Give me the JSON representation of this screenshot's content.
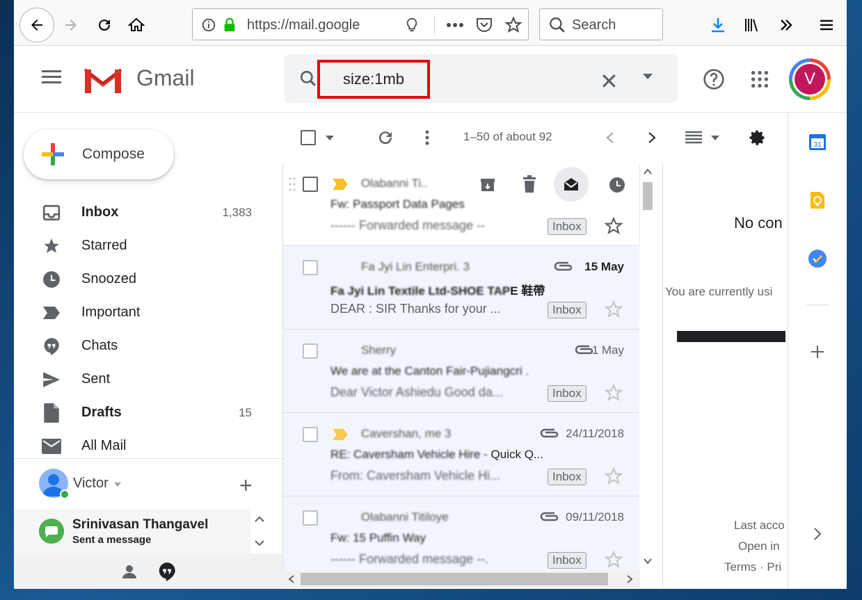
{
  "browser": {
    "url": "https://mail.google",
    "search_placeholder": "Search"
  },
  "gmail": {
    "logo_text": "Gmail",
    "search_query": "size:1mb",
    "avatar_letter": "V"
  },
  "sidebar": {
    "compose_label": "Compose",
    "items": [
      {
        "label": "Inbox",
        "count": "1,383",
        "icon": "inbox-icon",
        "bold": true
      },
      {
        "label": "Starred",
        "count": "",
        "icon": "star-icon"
      },
      {
        "label": "Snoozed",
        "count": "",
        "icon": "clock-icon"
      },
      {
        "label": "Important",
        "count": "",
        "icon": "important-icon"
      },
      {
        "label": "Chats",
        "count": "",
        "icon": "chat-icon"
      },
      {
        "label": "Sent",
        "count": "",
        "icon": "send-icon"
      },
      {
        "label": "Drafts",
        "count": "15",
        "icon": "draft-icon",
        "bold": true
      },
      {
        "label": "All Mail",
        "count": "",
        "icon": "mail-icon"
      }
    ],
    "hangouts_user": "Victor",
    "conversation": {
      "name": "Srinivasan Thangavel",
      "status": "Sent a message"
    }
  },
  "toolbar": {
    "paging": "1–50 of about 92"
  },
  "messages": [
    {
      "sender": "Olabanni Ti..",
      "subject": "Fw: Passport Data Pages",
      "snippet_blur": "------ Forwarded message --",
      "date": "",
      "label": "Inbox"
    },
    {
      "sender": "Fa Jyi Lin Enterpri. 3",
      "subject_blur": "Fa Jyi Lin Textile Ltd-SHOE TAP",
      "subject_clear": "E 鞋帶",
      "snippet": "DEAR : SIR Thanks for your ...",
      "date": "15 May",
      "label": "Inbox"
    },
    {
      "sender": "Sherry",
      "subject": "We are at the Canton Fair-Pujiangcri .",
      "snippet_blur": "Dear Victor Ashiedu Good da...",
      "date": "1 May",
      "label": "Inbox"
    },
    {
      "sender": "Cavershan, me 3",
      "subject_blur": "RE: Caversham Vehicle Hire - ",
      "subject_clear": "Quick Q...",
      "snippet_blur": "From: Caversham Vehicle Hi...",
      "date": "24/11/2018",
      "label": "Inbox"
    },
    {
      "sender": "Olabanni Titiloye",
      "subject": "Fw: 15 Puffin Way",
      "snippet_blur": "------ Forwarded message --.",
      "date": "09/11/2018",
      "label": "Inbox"
    }
  ],
  "reading_pane": {
    "no_conversation": "No con",
    "using": "You are currently usi",
    "last_activity": "Last acco",
    "open_in": "Open in",
    "terms": "Terms · Pri"
  },
  "colors": {
    "query_highlight": "#e8000b",
    "accent_blue": "#1a73e8",
    "avatar_bg": "#c2185b"
  }
}
